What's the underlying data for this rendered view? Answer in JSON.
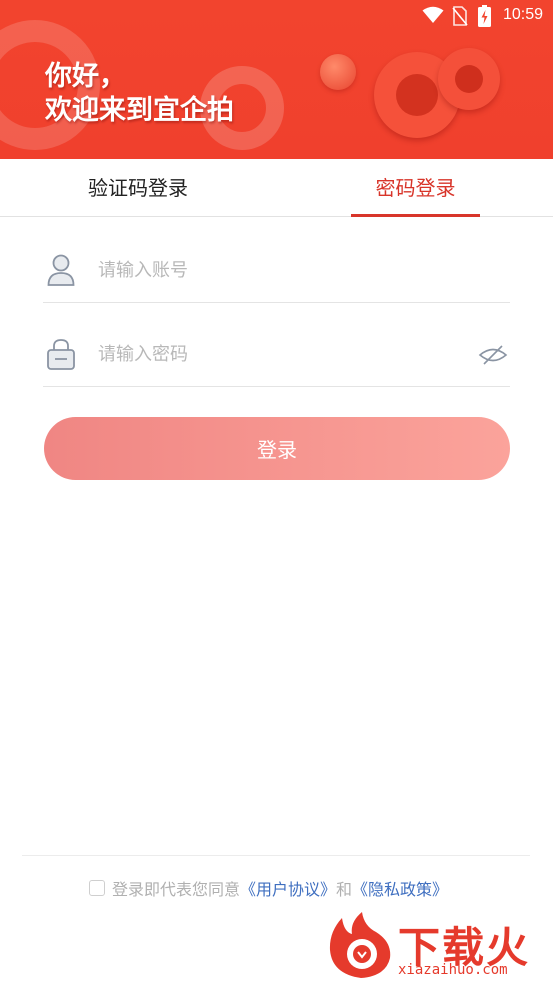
{
  "status_bar": {
    "time": "10:59"
  },
  "header": {
    "greeting_line1": "你好，",
    "greeting_line2": "欢迎来到宜企拍"
  },
  "tabs": [
    {
      "label": "验证码登录",
      "active": false
    },
    {
      "label": "密码登录",
      "active": true
    }
  ],
  "form": {
    "account": {
      "placeholder": "请输入账号",
      "value": ""
    },
    "password": {
      "placeholder": "请输入密码",
      "value": ""
    },
    "login_label": "登录"
  },
  "agreement": {
    "checked": false,
    "prefix": "登录即代表您同意",
    "user_agreement": "《用户协议》",
    "conjunction": "和",
    "privacy_policy": "《隐私政策》"
  },
  "watermark": {
    "logo_text": "下载火",
    "url": "xiazaihuo.com"
  },
  "colors": {
    "header_red": "#f2442e",
    "active_tab": "#d8352a",
    "button_start": "#f08683",
    "button_end": "#fba39b",
    "link": "#3f6fc0"
  },
  "icons": [
    "wifi-icon",
    "no-sim-icon",
    "battery-charging-icon",
    "user-icon",
    "lock-icon",
    "eye-off-icon"
  ]
}
